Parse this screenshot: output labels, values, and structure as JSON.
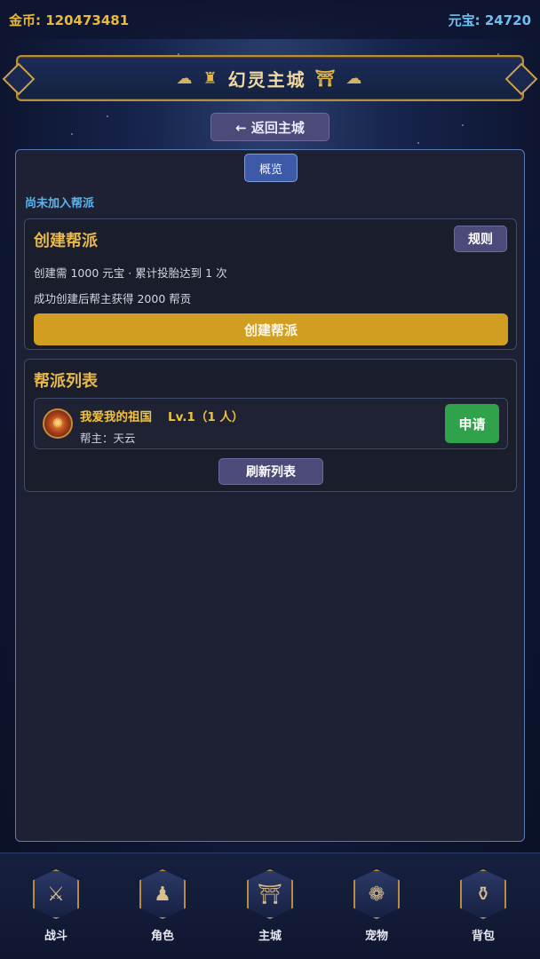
{
  "topbar": {
    "gold_label": "金币: 120473481",
    "ingot_label": "元宝: 24720"
  },
  "banner": {
    "title": "幻灵主城"
  },
  "back_button": {
    "label": "← 返回主城"
  },
  "tabs": {
    "overview": "概览"
  },
  "status": {
    "not_joined": "尚未加入帮派"
  },
  "create_card": {
    "title": "创建帮派",
    "rules_label": "规则",
    "requirement": "创建需 1000 元宝 · 累计投胎达到 1 次",
    "reward": "成功创建后帮主获得 2000 帮贡",
    "create_button": "创建帮派"
  },
  "list_card": {
    "title": "帮派列表",
    "guilds": [
      {
        "name": "我爱我的祖国",
        "level": "Lv.1（1 人）",
        "leader": "帮主：天云",
        "apply_label": "申请"
      }
    ],
    "refresh_button": "刷新列表"
  },
  "bottom_nav": {
    "items": [
      {
        "label": "战斗",
        "icon": "crossed-swords-icon"
      },
      {
        "label": "角色",
        "icon": "character-icon"
      },
      {
        "label": "主城",
        "icon": "palace-icon"
      },
      {
        "label": "宠物",
        "icon": "paw-icon"
      },
      {
        "label": "背包",
        "icon": "bag-icon"
      }
    ]
  },
  "colors": {
    "gold": "#e9b93b",
    "ingot": "#6fc0f0",
    "accent_button": "#d19e22",
    "apply_green": "#2fa24b",
    "panel_border": "#5a79b8"
  }
}
